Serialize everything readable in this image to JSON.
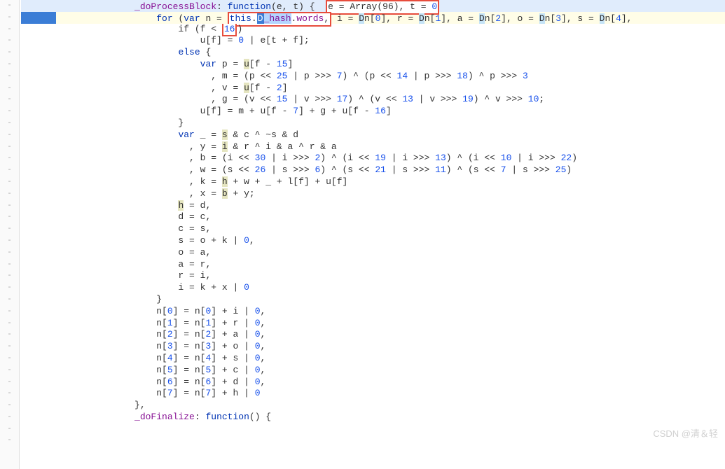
{
  "gutterMarker": "-",
  "lines": {
    "l1_pre": "                    ",
    "l1_prop": "_doProcessBlock",
    "l1_colon": ": ",
    "l1_fn": "function",
    "l1_paren": "(",
    "l1_e": "e",
    "l1_mid": ", t) {  ",
    "l1_box_e": "e",
    "l1_box_rest": " = Array(96), t = ",
    "l1_zero": "0",
    "l2_pre": "                        ",
    "l2_for": "for",
    "l2_open": " (",
    "l2_var": "var",
    "l2_n": " n = ",
    "l2_this": "this",
    "l2_dot1": ".",
    "l2_hash": "_hash",
    "l2_dot2": ".",
    "l2_words": "words",
    "l2_comma": ",",
    "l2_i": " i = ",
    "l2_n0": "n",
    "l2_br0": "[",
    "l2_0": "0",
    "l2_brc": "], r = ",
    "l2_n1": "n",
    "l2_br1": "[",
    "l2_1": "1",
    "l2_brc1": "], a = ",
    "l2_n2": "n",
    "l2_br2": "[",
    "l2_2": "2",
    "l2_brc2": "], o = ",
    "l2_n3": "n",
    "l2_br3": "[",
    "l2_3": "3",
    "l2_brc3": "], s = ",
    "l2_n4": "n",
    "l2_br4": "[",
    "l2_4": "4",
    "l2_brc4": "],",
    "l3": "                            if (f < ",
    "l3_16": "16",
    "l3_close": ")",
    "l4": "                                u[f] = ",
    "l4_0": "0",
    "l4_rest": " | e[t + f];",
    "l5": "                            ",
    "l5_else": "else",
    "l5_brace": " {",
    "l6": "                                ",
    "l6_var": "var",
    "l6_p": " p = ",
    "l6_u": "u",
    "l6_rest": "[f - ",
    "l6_15": "15",
    "l6_close": "]",
    "l7": "                                  , m = (p << ",
    "l7_25": "25",
    "l7_a": " | p >>> ",
    "l7_7": "7",
    "l7_b": ") ^ (p << ",
    "l7_14": "14",
    "l7_c": " | p >>> ",
    "l7_18": "18",
    "l7_d": ") ^ p >>> ",
    "l7_3": "3",
    "l8": "                                  , v = ",
    "l8_u": "u",
    "l8_rest": "[f - ",
    "l8_2": "2",
    "l8_close": "]",
    "l9": "                                  , g = (v << ",
    "l9_15": "15",
    "l9_a": " | v >>> ",
    "l9_17": "17",
    "l9_b": ") ^ (v << ",
    "l9_13": "13",
    "l9_c": " | v >>> ",
    "l9_19": "19",
    "l9_d": ") ^ v >>> ",
    "l9_10": "10",
    "l9_semi": ";",
    "l10": "                                u[f] = m + u[f - ",
    "l10_7": "7",
    "l10_a": "] + g + u[f - ",
    "l10_16": "16",
    "l10_close": "]",
    "l11": "                            }",
    "l12": "                            ",
    "l12_var": "var",
    "l12_u": " _ = ",
    "l12_s": "s",
    "l12_rest": " & c ^ ~s & d",
    "l13": "                              , y = ",
    "l13_i": "i",
    "l13_rest": " & r ^ i & a ^ r & a",
    "l14": "                              , b = (i << ",
    "l14_30": "30",
    "l14_a": " | i >>> ",
    "l14_2": "2",
    "l14_b": ") ^ (i << ",
    "l14_19": "19",
    "l14_c": " | i >>> ",
    "l14_13": "13",
    "l14_d": ") ^ (i << ",
    "l14_10": "10",
    "l14_e": " | i >>> ",
    "l14_22": "22",
    "l14_close": ")",
    "l15": "                              , w = (s << ",
    "l15_26": "26",
    "l15_a": " | s >>> ",
    "l15_6": "6",
    "l15_b": ") ^ (s << ",
    "l15_21": "21",
    "l15_c": " | s >>> ",
    "l15_11": "11",
    "l15_d": ") ^ (s << ",
    "l15_7": "7",
    "l15_e": " | s >>> ",
    "l15_25": "25",
    "l15_close": ")",
    "l16": "                              , k = ",
    "l16_h": "h",
    "l16_rest": " + w + _ + l[f] + u[f]",
    "l17": "                              , x = ",
    "l17_b": "b",
    "l17_rest": " + y;",
    "l18": "                            ",
    "l18_h": "h",
    "l18_rest": " = d,",
    "l19": "                            d = c,",
    "l20": "                            c = s,",
    "l21": "                            s = o + k | ",
    "l21_0": "0",
    "l21_c": ",",
    "l22": "                            o = a,",
    "l23": "                            a = r,",
    "l24": "                            r = i,",
    "l25": "                            i = k + x | ",
    "l25_0": "0",
    "l26": "                        }",
    "l27": "                        n[",
    "l27_0": "0",
    "l27_a": "] = n[",
    "l27_0b": "0",
    "l27_b": "] + i | ",
    "l27_0c": "0",
    "l27_c": ",",
    "l28_1": "1",
    "l28_r": "r",
    "l29_2": "2",
    "l29_a": "a",
    "l30_3": "3",
    "l30_o": "o",
    "l31_4": "4",
    "l31_s": "s",
    "l32_5": "5",
    "l32_c": "c",
    "l33_6": "6",
    "l33_d": "d",
    "l34_7": "7",
    "l34_h": "h",
    "l35": "                    },",
    "l36_pre": "                    ",
    "l36_prop": "_doFinalize",
    "l36_colon": ": ",
    "l36_fn": "function",
    "l36_rest": "() {",
    "watermark": "CSDN @清＆轻"
  }
}
